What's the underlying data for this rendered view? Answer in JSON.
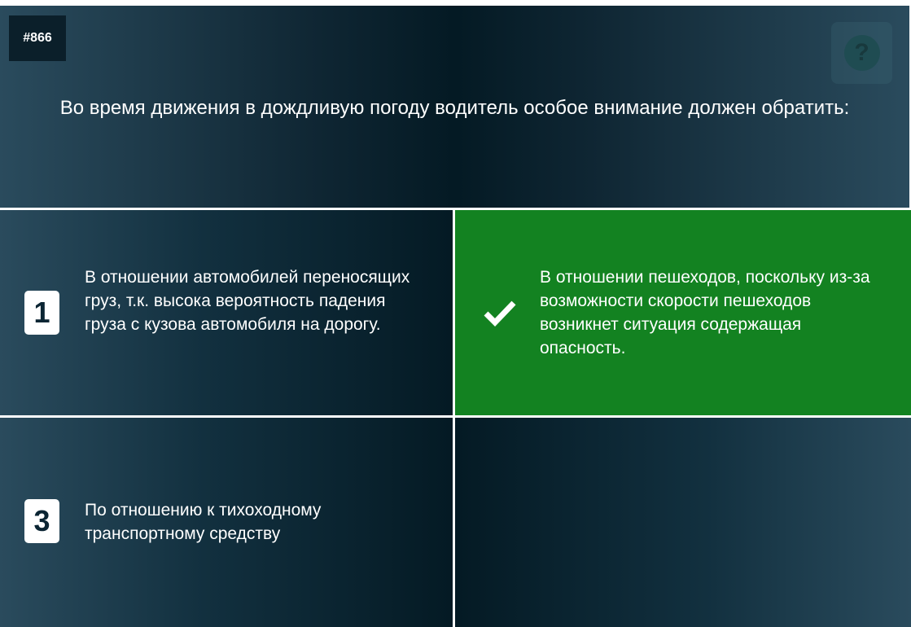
{
  "question": {
    "id": "#866",
    "text": "Во время движения в дождливую погоду водитель особое внимание должен обратить:",
    "help_icon_symbol": "?"
  },
  "answers": [
    {
      "badge": "1",
      "state": "default",
      "text": "В отношении автомобилей переносящих груз, т.к. высока вероятность падения груза с кузова автомобиля на дорогу."
    },
    {
      "badge": "check-icon",
      "state": "correct",
      "text": "В отношении пешеходов, поскольку из-за возможности скорости пешеходов возникнет ситуация содержащая опасность."
    },
    {
      "badge": "3",
      "state": "default",
      "text": "По отношению к тихоходному транспортному средству"
    },
    {
      "badge": "",
      "state": "empty",
      "text": ""
    }
  ],
  "colors": {
    "panel_dark": "#041a24",
    "panel_light": "#2a4b5d",
    "correct_green": "#138221",
    "badge_text": "#0b2533"
  }
}
